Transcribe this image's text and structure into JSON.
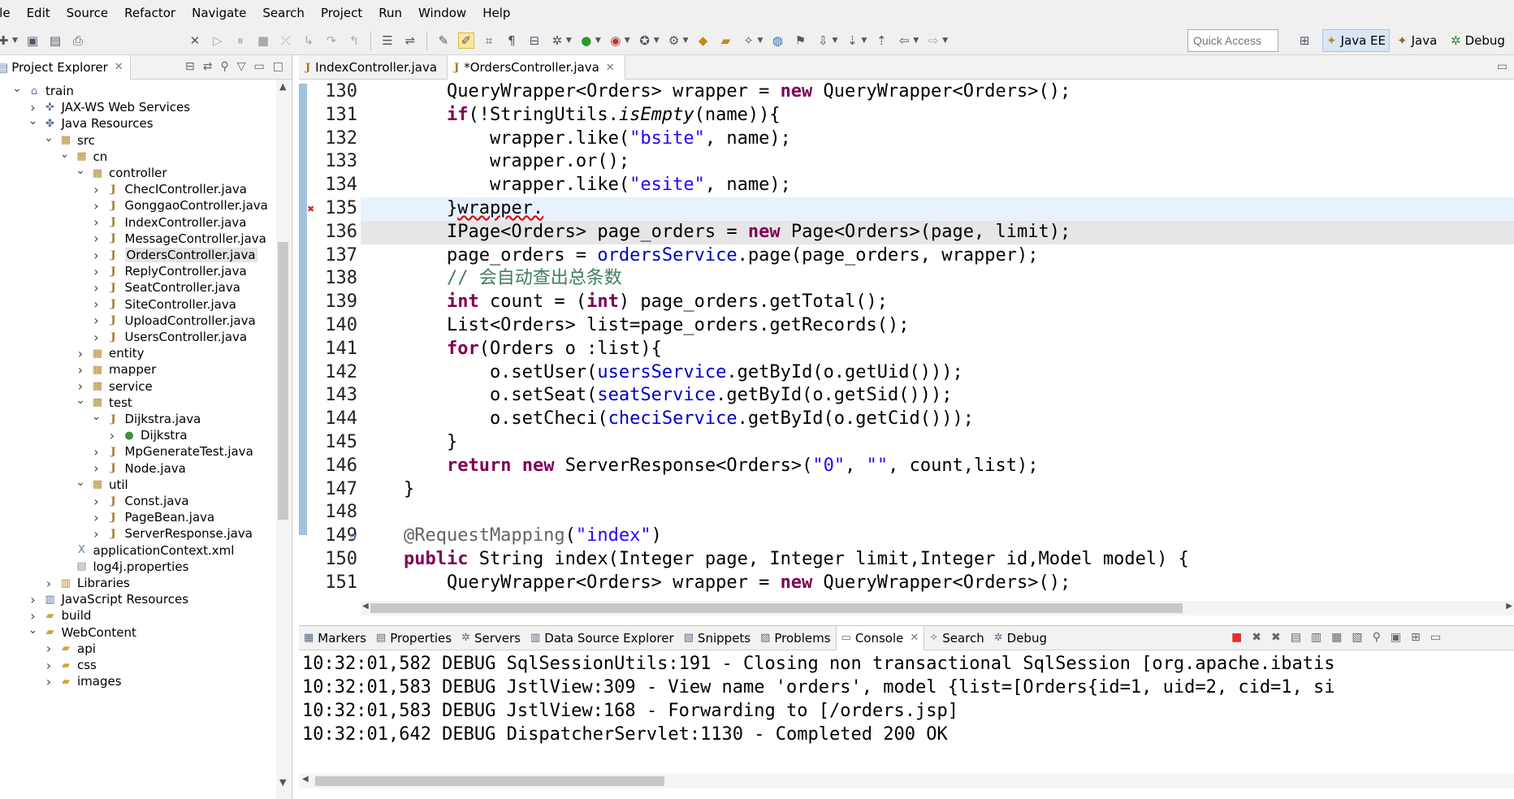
{
  "menu": [
    "ile",
    "Edit",
    "Source",
    "Refactor",
    "Navigate",
    "Search",
    "Project",
    "Run",
    "Window",
    "Help"
  ],
  "toolbar": {
    "quick_access_placeholder": "Quick Access",
    "perspectives": [
      "Java EE",
      "Java",
      "Debug"
    ]
  },
  "project_explorer": {
    "title": "Project Explorer",
    "tree": [
      {
        "label": "train",
        "depth": 0,
        "expanded": true,
        "icon": "project-icon"
      },
      {
        "label": "JAX-WS Web Services",
        "depth": 1,
        "expanded": false,
        "icon": "webservice-icon"
      },
      {
        "label": "Java Resources",
        "depth": 1,
        "expanded": true,
        "icon": "java-resources-icon"
      },
      {
        "label": "src",
        "depth": 2,
        "expanded": true,
        "icon": "source-folder-icon"
      },
      {
        "label": "cn",
        "depth": 3,
        "expanded": true,
        "icon": "package-icon"
      },
      {
        "label": "controller",
        "depth": 4,
        "expanded": true,
        "icon": "package-icon"
      },
      {
        "label": "ChecIController.java",
        "depth": 5,
        "expanded": false,
        "icon": "java-file-icon"
      },
      {
        "label": "GonggaoController.java",
        "depth": 5,
        "expanded": false,
        "icon": "java-file-icon"
      },
      {
        "label": "IndexController.java",
        "depth": 5,
        "expanded": false,
        "icon": "java-file-icon"
      },
      {
        "label": "MessageController.java",
        "depth": 5,
        "expanded": false,
        "icon": "java-file-icon"
      },
      {
        "label": "OrdersController.java",
        "depth": 5,
        "expanded": false,
        "icon": "java-file-icon",
        "selected": true
      },
      {
        "label": "ReplyController.java",
        "depth": 5,
        "expanded": false,
        "icon": "java-file-icon"
      },
      {
        "label": "SeatController.java",
        "depth": 5,
        "expanded": false,
        "icon": "java-file-icon"
      },
      {
        "label": "SiteController.java",
        "depth": 5,
        "expanded": false,
        "icon": "java-file-icon"
      },
      {
        "label": "UploadController.java",
        "depth": 5,
        "expanded": false,
        "icon": "java-file-icon"
      },
      {
        "label": "UsersController.java",
        "depth": 5,
        "expanded": false,
        "icon": "java-file-icon"
      },
      {
        "label": "entity",
        "depth": 4,
        "expanded": false,
        "icon": "package-icon"
      },
      {
        "label": "mapper",
        "depth": 4,
        "expanded": false,
        "icon": "package-icon"
      },
      {
        "label": "service",
        "depth": 4,
        "expanded": false,
        "icon": "package-icon"
      },
      {
        "label": "test",
        "depth": 4,
        "expanded": true,
        "icon": "package-icon"
      },
      {
        "label": "Dijkstra.java",
        "depth": 5,
        "expanded": true,
        "icon": "java-file-icon"
      },
      {
        "label": "Dijkstra",
        "depth": 6,
        "expanded": false,
        "icon": "class-icon"
      },
      {
        "label": "MpGenerateTest.java",
        "depth": 5,
        "expanded": false,
        "icon": "java-file-icon"
      },
      {
        "label": "Node.java",
        "depth": 5,
        "expanded": false,
        "icon": "java-file-icon"
      },
      {
        "label": "util",
        "depth": 4,
        "expanded": true,
        "icon": "package-icon"
      },
      {
        "label": "Const.java",
        "depth": 5,
        "expanded": false,
        "icon": "java-file-icon"
      },
      {
        "label": "PageBean.java",
        "depth": 5,
        "expanded": false,
        "icon": "java-file-icon"
      },
      {
        "label": "ServerResponse.java",
        "depth": 5,
        "expanded": false,
        "icon": "java-file-icon"
      },
      {
        "label": "applicationContext.xml",
        "depth": 3,
        "expanded": null,
        "icon": "xml-file-icon"
      },
      {
        "label": "log4j.properties",
        "depth": 3,
        "expanded": null,
        "icon": "properties-file-icon"
      },
      {
        "label": "Libraries",
        "depth": 2,
        "expanded": false,
        "icon": "libraries-icon"
      },
      {
        "label": "JavaScript Resources",
        "depth": 1,
        "expanded": false,
        "icon": "js-resources-icon"
      },
      {
        "label": "build",
        "depth": 1,
        "expanded": false,
        "icon": "folder-icon"
      },
      {
        "label": "WebContent",
        "depth": 1,
        "expanded": true,
        "icon": "folder-icon"
      },
      {
        "label": "api",
        "depth": 2,
        "expanded": false,
        "icon": "folder-icon"
      },
      {
        "label": "css",
        "depth": 2,
        "expanded": false,
        "icon": "folder-icon"
      },
      {
        "label": "images",
        "depth": 2,
        "expanded": false,
        "icon": "folder-icon"
      }
    ]
  },
  "editor": {
    "tabs": [
      {
        "label": "IndexController.java",
        "active": false,
        "closable": false
      },
      {
        "label": "*OrdersController.java",
        "active": true,
        "closable": true
      }
    ],
    "lines": [
      {
        "num": "130",
        "tokens": [
          [
            "",
            "        QueryWrapper<Orders> wrapper = "
          ],
          [
            "kw",
            "new"
          ],
          [
            "",
            " QueryWrapper<Orders>();"
          ]
        ]
      },
      {
        "num": "131",
        "tokens": [
          [
            "",
            "        "
          ],
          [
            "kw",
            "if"
          ],
          [
            "",
            "(!StringUtils."
          ],
          [
            "ital",
            "isEmpty"
          ],
          [
            "",
            "(name)){"
          ]
        ]
      },
      {
        "num": "132",
        "tokens": [
          [
            "",
            "            wrapper.like("
          ],
          [
            "str",
            "\"bsite\""
          ],
          [
            "",
            ", name);"
          ]
        ]
      },
      {
        "num": "133",
        "tokens": [
          [
            "",
            "            wrapper.or();"
          ]
        ]
      },
      {
        "num": "134",
        "tokens": [
          [
            "",
            "            wrapper.like("
          ],
          [
            "str",
            "\"esite\""
          ],
          [
            "",
            ", name);"
          ]
        ]
      },
      {
        "num": "135",
        "tokens": [
          [
            "",
            "        }"
          ],
          [
            "err",
            "wrapper."
          ]
        ],
        "current": true,
        "error": true
      },
      {
        "num": "136",
        "tokens": [
          [
            "",
            "        IPage<Orders> page_orders = "
          ],
          [
            "kw",
            "new"
          ],
          [
            "",
            " Page<Orders>(page, limit);"
          ]
        ],
        "selected_bg": true
      },
      {
        "num": "137",
        "tokens": [
          [
            "",
            "        page_orders = "
          ],
          [
            "fld",
            "ordersService"
          ],
          [
            "",
            ".page(page_orders, wrapper);"
          ]
        ]
      },
      {
        "num": "138",
        "tokens": [
          [
            "cmt",
            "        // 会自动查出总条数"
          ]
        ]
      },
      {
        "num": "139",
        "tokens": [
          [
            "",
            "        "
          ],
          [
            "kw",
            "int"
          ],
          [
            "",
            " count = ("
          ],
          [
            "kw",
            "int"
          ],
          [
            "",
            ") page_orders.getTotal();"
          ]
        ]
      },
      {
        "num": "140",
        "tokens": [
          [
            "",
            "        List<Orders> list=page_orders.getRecords();"
          ]
        ]
      },
      {
        "num": "141",
        "tokens": [
          [
            "",
            "        "
          ],
          [
            "kw",
            "for"
          ],
          [
            "",
            "(Orders o :list){"
          ]
        ]
      },
      {
        "num": "142",
        "tokens": [
          [
            "",
            "            o.setUser("
          ],
          [
            "fld",
            "usersService"
          ],
          [
            "",
            ".getById(o.getUid()));"
          ]
        ]
      },
      {
        "num": "143",
        "tokens": [
          [
            "",
            "            o.setSeat("
          ],
          [
            "fld",
            "seatService"
          ],
          [
            "",
            ".getById(o.getSid()));"
          ]
        ]
      },
      {
        "num": "144",
        "tokens": [
          [
            "",
            "            o.setCheci("
          ],
          [
            "fld",
            "checiService"
          ],
          [
            "",
            ".getById(o.getCid()));"
          ]
        ]
      },
      {
        "num": "145",
        "tokens": [
          [
            "",
            "        }"
          ]
        ]
      },
      {
        "num": "146",
        "tokens": [
          [
            "",
            "        "
          ],
          [
            "kw",
            "return"
          ],
          [
            "",
            " "
          ],
          [
            "kw",
            "new"
          ],
          [
            "",
            " ServerResponse<Orders>("
          ],
          [
            "str",
            "\"0\""
          ],
          [
            "",
            ", "
          ],
          [
            "str",
            "\"\""
          ],
          [
            "",
            ", count,list);"
          ]
        ]
      },
      {
        "num": "147",
        "tokens": [
          [
            "",
            "    }"
          ]
        ]
      },
      {
        "num": "148",
        "tokens": [
          [
            "",
            ""
          ]
        ]
      },
      {
        "num": "149",
        "tokens": [
          [
            "ann",
            "    @RequestMapping"
          ],
          [
            "",
            "("
          ],
          [
            "str",
            "\"index\""
          ],
          [
            "",
            ")"
          ]
        ],
        "fold": true
      },
      {
        "num": "150",
        "tokens": [
          [
            "",
            "    "
          ],
          [
            "kw",
            "public"
          ],
          [
            "",
            " String index(Integer page, Integer limit,Integer id,Model model) {"
          ]
        ]
      },
      {
        "num": "151",
        "tokens": [
          [
            "",
            "        QueryWrapper<Orders> wrapper = "
          ],
          [
            "kw",
            "new"
          ],
          [
            "",
            " QueryWrapper<Orders>();"
          ]
        ]
      }
    ]
  },
  "bottom_panel": {
    "tabs": [
      {
        "label": "Markers",
        "icon": "markers-icon",
        "active": false
      },
      {
        "label": "Properties",
        "icon": "properties-icon",
        "active": false
      },
      {
        "label": "Servers",
        "icon": "servers-icon",
        "active": false
      },
      {
        "label": "Data Source Explorer",
        "icon": "datasource-icon",
        "active": false
      },
      {
        "label": "Snippets",
        "icon": "snippets-icon",
        "active": false
      },
      {
        "label": "Problems",
        "icon": "problems-icon",
        "active": false
      },
      {
        "label": "Console",
        "icon": "console-icon",
        "active": true
      },
      {
        "label": "Search",
        "icon": "search-icon",
        "active": false
      },
      {
        "label": "Debug",
        "icon": "debug-icon",
        "active": false
      }
    ],
    "console_lines": [
      "10:32:01,582 DEBUG SqlSessionUtils:191 - Closing non transactional SqlSession [org.apache.ibatis",
      "10:32:01,583 DEBUG JstlView:309 - View name 'orders', model {list=[Orders{id=1, uid=2, cid=1, si",
      "10:32:01,583 DEBUG JstlView:168 - Forwarding to [/orders.jsp]",
      "10:32:01,642 DEBUG DispatcherServlet:1130 - Completed 200 OK"
    ]
  },
  "colors": {
    "keyword": "#7f0055",
    "string": "#2a00ff",
    "field": "#0000c0",
    "comment": "#3f7f5f",
    "current_line": "#e8f2fe"
  }
}
